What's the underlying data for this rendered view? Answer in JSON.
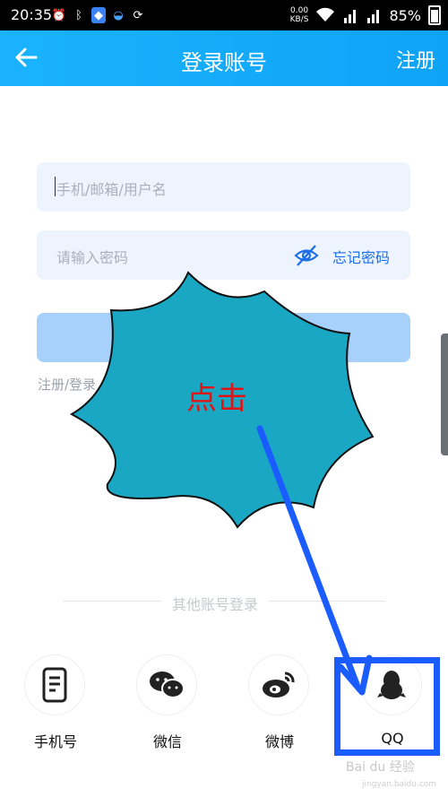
{
  "status_bar": {
    "time": "20:35",
    "net_speed_value": "0.00",
    "net_speed_unit": "KB/S",
    "battery": "85%",
    "icons": [
      "alarm-icon",
      "bluetooth-icon",
      "shield-icon",
      "qq-icon",
      "sync-icon",
      "wifi-icon",
      "signal-icon",
      "signal-4g-icon",
      "battery-icon"
    ]
  },
  "header": {
    "title": "登录账号",
    "register": "注册",
    "back_icon": "arrow-left-icon"
  },
  "form": {
    "account_placeholder": "手机/邮箱/用户名",
    "password_placeholder": "请输入密码",
    "forgot_password": "忘记密码",
    "agreement_text": "注册/登录"
  },
  "other_login": {
    "label": "其他账号登录",
    "methods": [
      {
        "label": "手机号",
        "icon": "phone-icon"
      },
      {
        "label": "微信",
        "icon": "wechat-icon"
      },
      {
        "label": "微博",
        "icon": "weibo-icon"
      },
      {
        "label": "QQ",
        "icon": "qq-penguin-icon"
      }
    ]
  },
  "annotation": {
    "click_text": "点击",
    "burst_color": "#19a7c4",
    "arrow_color": "#1a5cff"
  },
  "watermark": {
    "brand": "Bai du 经验",
    "sub": "jingyan.baidu.com"
  },
  "colors": {
    "header": "#10a8f8",
    "field_bg": "#eef4fe",
    "login_btn": "#a7d0fb",
    "link": "#1e6ee8",
    "click_text": "#e01414"
  }
}
